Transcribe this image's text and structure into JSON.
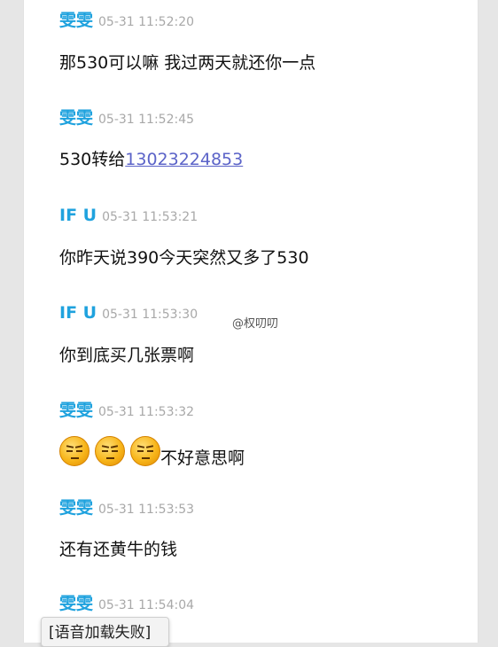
{
  "messages": [
    {
      "sender": "雯雯",
      "time": "05-31 11:52:20",
      "text": "那530可以嘛 我过两天就还你一点"
    },
    {
      "sender": "雯雯",
      "time": "05-31 11:52:45",
      "text_prefix": "530转给",
      "phone": "13023224853"
    },
    {
      "sender": "IF U",
      "time": "05-31 11:53:21",
      "text": "你昨天说390今天突然又多了530"
    },
    {
      "sender": "IF U",
      "time": "05-31 11:53:30",
      "text": "你到底买几张票啊"
    },
    {
      "sender": "雯雯",
      "time": "05-31 11:53:32",
      "emoji_icon": "sneering-face-icon",
      "emoji_count": 3,
      "text": "不好意思啊"
    },
    {
      "sender": "雯雯",
      "time": "05-31 11:53:53",
      "text": "还有还黄牛的钱"
    },
    {
      "sender": "雯雯",
      "time": "05-31 11:54:04",
      "text": "[语音加载失败]"
    }
  ],
  "watermark": "@权叨叨",
  "colors": {
    "sender": "#1fa2de",
    "time": "#a8a8a8",
    "link": "#5b63c8"
  }
}
